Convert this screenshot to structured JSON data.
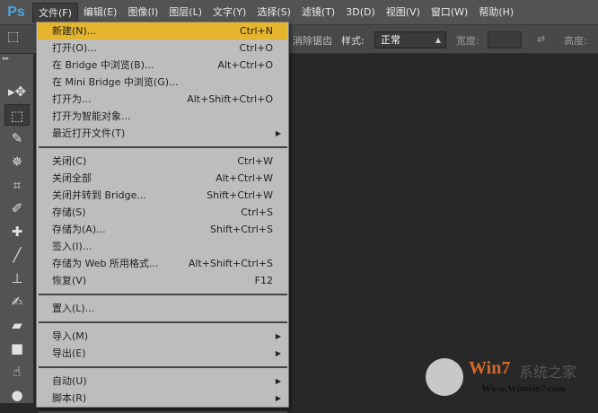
{
  "app": {
    "logo": "Ps"
  },
  "menubar": [
    "文件(F)",
    "编辑(E)",
    "图像(I)",
    "图层(L)",
    "文字(Y)",
    "选择(S)",
    "滤镜(T)",
    "3D(D)",
    "视图(V)",
    "窗口(W)",
    "帮助(H)"
  ],
  "options": {
    "antialias": "消除锯齿",
    "style_label": "样式:",
    "style_value": "正常",
    "width_label": "宽度:",
    "height_label": "高度:"
  },
  "tools": [
    "move",
    "rect-marquee",
    "lasso",
    "magic-wand",
    "crop",
    "eyedropper",
    "healing",
    "brush",
    "stamp",
    "history-brush",
    "eraser",
    "gradient",
    "smudge",
    "dodge"
  ],
  "file_menu": [
    {
      "label": "新建(N)...",
      "shortcut": "Ctrl+N",
      "highlighted": true
    },
    {
      "label": "打开(O)...",
      "shortcut": "Ctrl+O"
    },
    {
      "label": "在 Bridge 中浏览(B)...",
      "shortcut": "Alt+Ctrl+O"
    },
    {
      "label": "在 Mini Bridge 中浏览(G)...",
      "shortcut": ""
    },
    {
      "label": "打开为...",
      "shortcut": "Alt+Shift+Ctrl+O"
    },
    {
      "label": "打开为智能对象...",
      "shortcut": ""
    },
    {
      "label": "最近打开文件(T)",
      "submenu": true
    },
    {
      "sep": true
    },
    {
      "label": "关闭(C)",
      "shortcut": "Ctrl+W"
    },
    {
      "label": "关闭全部",
      "shortcut": "Alt+Ctrl+W"
    },
    {
      "label": "关闭并转到 Bridge...",
      "shortcut": "Shift+Ctrl+W"
    },
    {
      "label": "存储(S)",
      "shortcut": "Ctrl+S"
    },
    {
      "label": "存储为(A)...",
      "shortcut": "Shift+Ctrl+S"
    },
    {
      "label": "签入(I)...",
      "shortcut": ""
    },
    {
      "label": "存储为 Web 所用格式...",
      "shortcut": "Alt+Shift+Ctrl+S"
    },
    {
      "label": "恢复(V)",
      "shortcut": "F12"
    },
    {
      "sep": true
    },
    {
      "label": "置入(L)...",
      "shortcut": ""
    },
    {
      "sep": true
    },
    {
      "label": "导入(M)",
      "submenu": true
    },
    {
      "label": "导出(E)",
      "submenu": true
    },
    {
      "sep": true
    },
    {
      "label": "自动(U)",
      "submenu": true
    },
    {
      "label": "脚本(R)",
      "submenu": true
    },
    {
      "sep": true
    }
  ],
  "watermark": {
    "brand": "Win7",
    "brand_cn": "系统之家",
    "url": "Www.Winwin7.com"
  },
  "colors": {
    "highlight": "#e5b52e",
    "menu_bg": "#bdbdbd",
    "chrome": "#535353",
    "canvas": "#282828"
  }
}
